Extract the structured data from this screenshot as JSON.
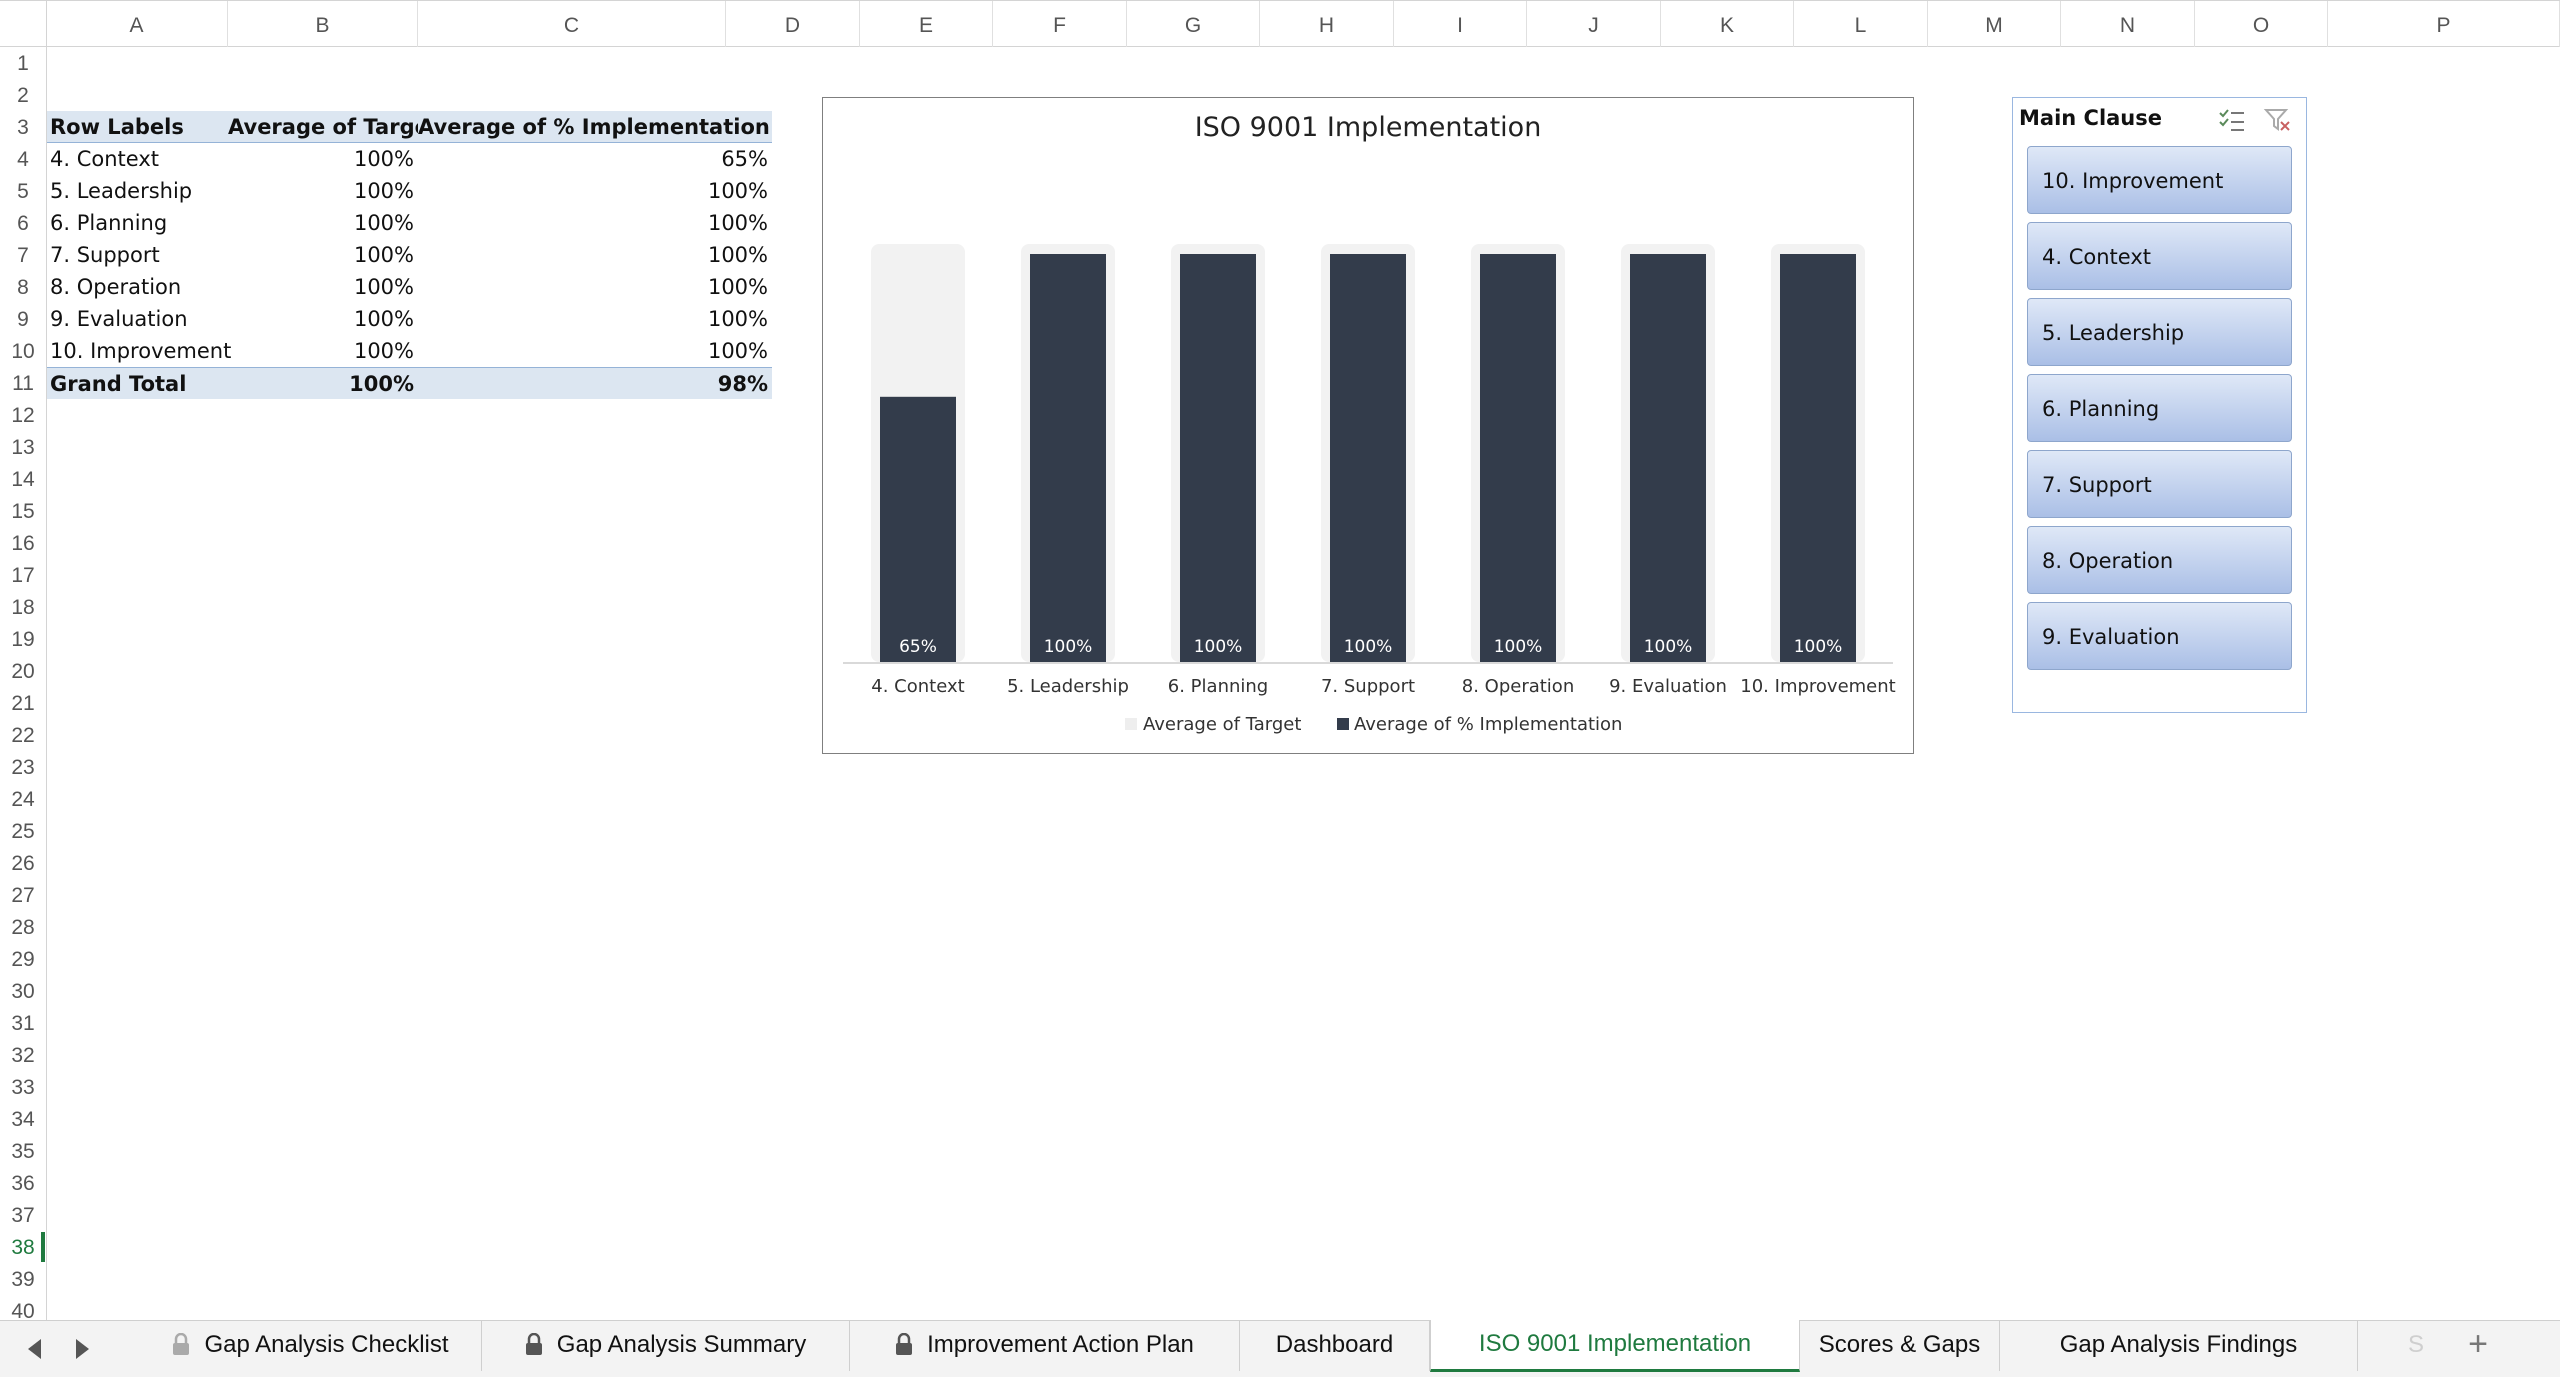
{
  "columns": [
    "A",
    "B",
    "C",
    "D",
    "E",
    "F",
    "G",
    "H",
    "I",
    "J",
    "K",
    "L",
    "M",
    "N",
    "O",
    "P"
  ],
  "rows": [
    "1",
    "2",
    "3",
    "4",
    "5",
    "6",
    "7",
    "8",
    "9",
    "10",
    "11",
    "12",
    "13",
    "14",
    "15",
    "16",
    "17",
    "18",
    "19",
    "20",
    "21",
    "22",
    "23",
    "24",
    "25",
    "26",
    "27",
    "28",
    "29",
    "30",
    "31",
    "32",
    "33",
    "34",
    "35",
    "36",
    "37",
    "38",
    "39",
    "40"
  ],
  "active_row": "38",
  "pivot": {
    "headers": [
      "Row Labels",
      "Average of Target",
      "Average of % Implementation"
    ],
    "rows": [
      [
        "4. Context",
        "100%",
        "65%"
      ],
      [
        "5. Leadership",
        "100%",
        "100%"
      ],
      [
        "6. Planning",
        "100%",
        "100%"
      ],
      [
        "7. Support",
        "100%",
        "100%"
      ],
      [
        "8. Operation",
        "100%",
        "100%"
      ],
      [
        "9. Evaluation",
        "100%",
        "100%"
      ],
      [
        "10. Improvement",
        "100%",
        "100%"
      ]
    ],
    "total": [
      "Grand Total",
      "100%",
      "98%"
    ]
  },
  "chart_data": {
    "type": "bar",
    "title": "ISO 9001 Implementation",
    "categories": [
      "4. Context",
      "5. Leadership",
      "6. Planning",
      "7. Support",
      "8. Operation",
      "9. Evaluation",
      "10. Improvement"
    ],
    "series": [
      {
        "name": "Average of Target",
        "values": [
          100,
          100,
          100,
          100,
          100,
          100,
          100
        ],
        "color": "#f2f2f2"
      },
      {
        "name": "Average of % Implementation",
        "values": [
          65,
          100,
          100,
          100,
          100,
          100,
          100
        ],
        "color": "#333c4b"
      }
    ],
    "data_labels": [
      "65%",
      "100%",
      "100%",
      "100%",
      "100%",
      "100%",
      "100%"
    ],
    "ylim": [
      0,
      100
    ],
    "legend": "bottom",
    "grid": false
  },
  "slicer": {
    "title": "Main Clause",
    "items": [
      "10. Improvement",
      "4. Context",
      "5. Leadership",
      "6. Planning",
      "7. Support",
      "8. Operation",
      "9. Evaluation"
    ]
  },
  "tabs": [
    {
      "label": "Gap Analysis Checklist",
      "locked": true
    },
    {
      "label": "Gap Analysis Summary",
      "locked": true
    },
    {
      "label": "Improvement Action Plan",
      "locked": true
    },
    {
      "label": "Dashboard",
      "locked": false
    },
    {
      "label": "ISO 9001 Implementation",
      "locked": false,
      "active": true
    },
    {
      "label": "Scores & Gaps",
      "locked": false
    },
    {
      "label": "Gap Analysis Findings",
      "locked": false
    }
  ],
  "tab_overflow": "S",
  "add_sheet_label": "+",
  "colors": {
    "accent": "#1f7a3f",
    "bar_dark": "#333c4b",
    "bar_light": "#f2f2f2",
    "pivot_header": "#dce6f1"
  }
}
